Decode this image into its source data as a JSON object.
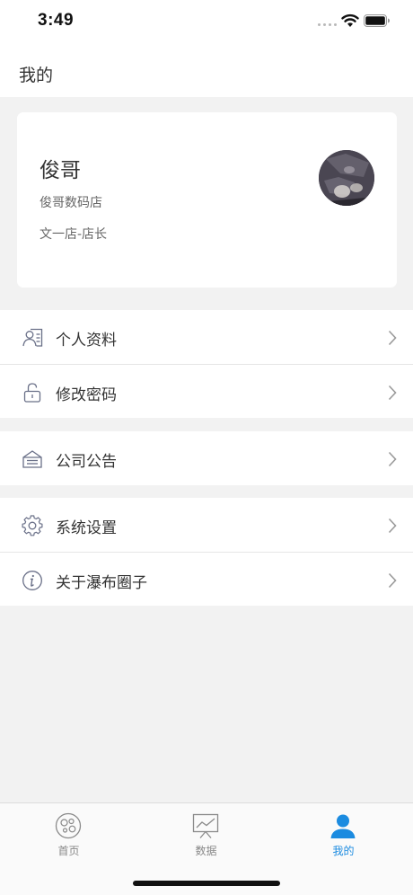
{
  "status_bar": {
    "time": "3:49"
  },
  "header": {
    "title": "我的"
  },
  "profile": {
    "name": "俊哥",
    "store": "俊哥数码店",
    "role": "文一店-店长"
  },
  "menu": {
    "profile_info": "个人资料",
    "change_password": "修改密码",
    "company_notice": "公司公告",
    "system_settings": "系统设置",
    "about": "关于瀑布圈子"
  },
  "tabs": {
    "home": "首页",
    "data": "数据",
    "mine": "我的"
  },
  "colors": {
    "accent": "#1b8be0",
    "inactive": "#888888",
    "background": "#f2f2f2"
  },
  "icons": [
    "wifi-icon",
    "battery-icon",
    "id-card-icon",
    "unlock-icon",
    "notice-icon",
    "gear-icon",
    "info-icon",
    "chevron-right-icon",
    "home-icon",
    "chart-board-icon",
    "person-icon"
  ]
}
